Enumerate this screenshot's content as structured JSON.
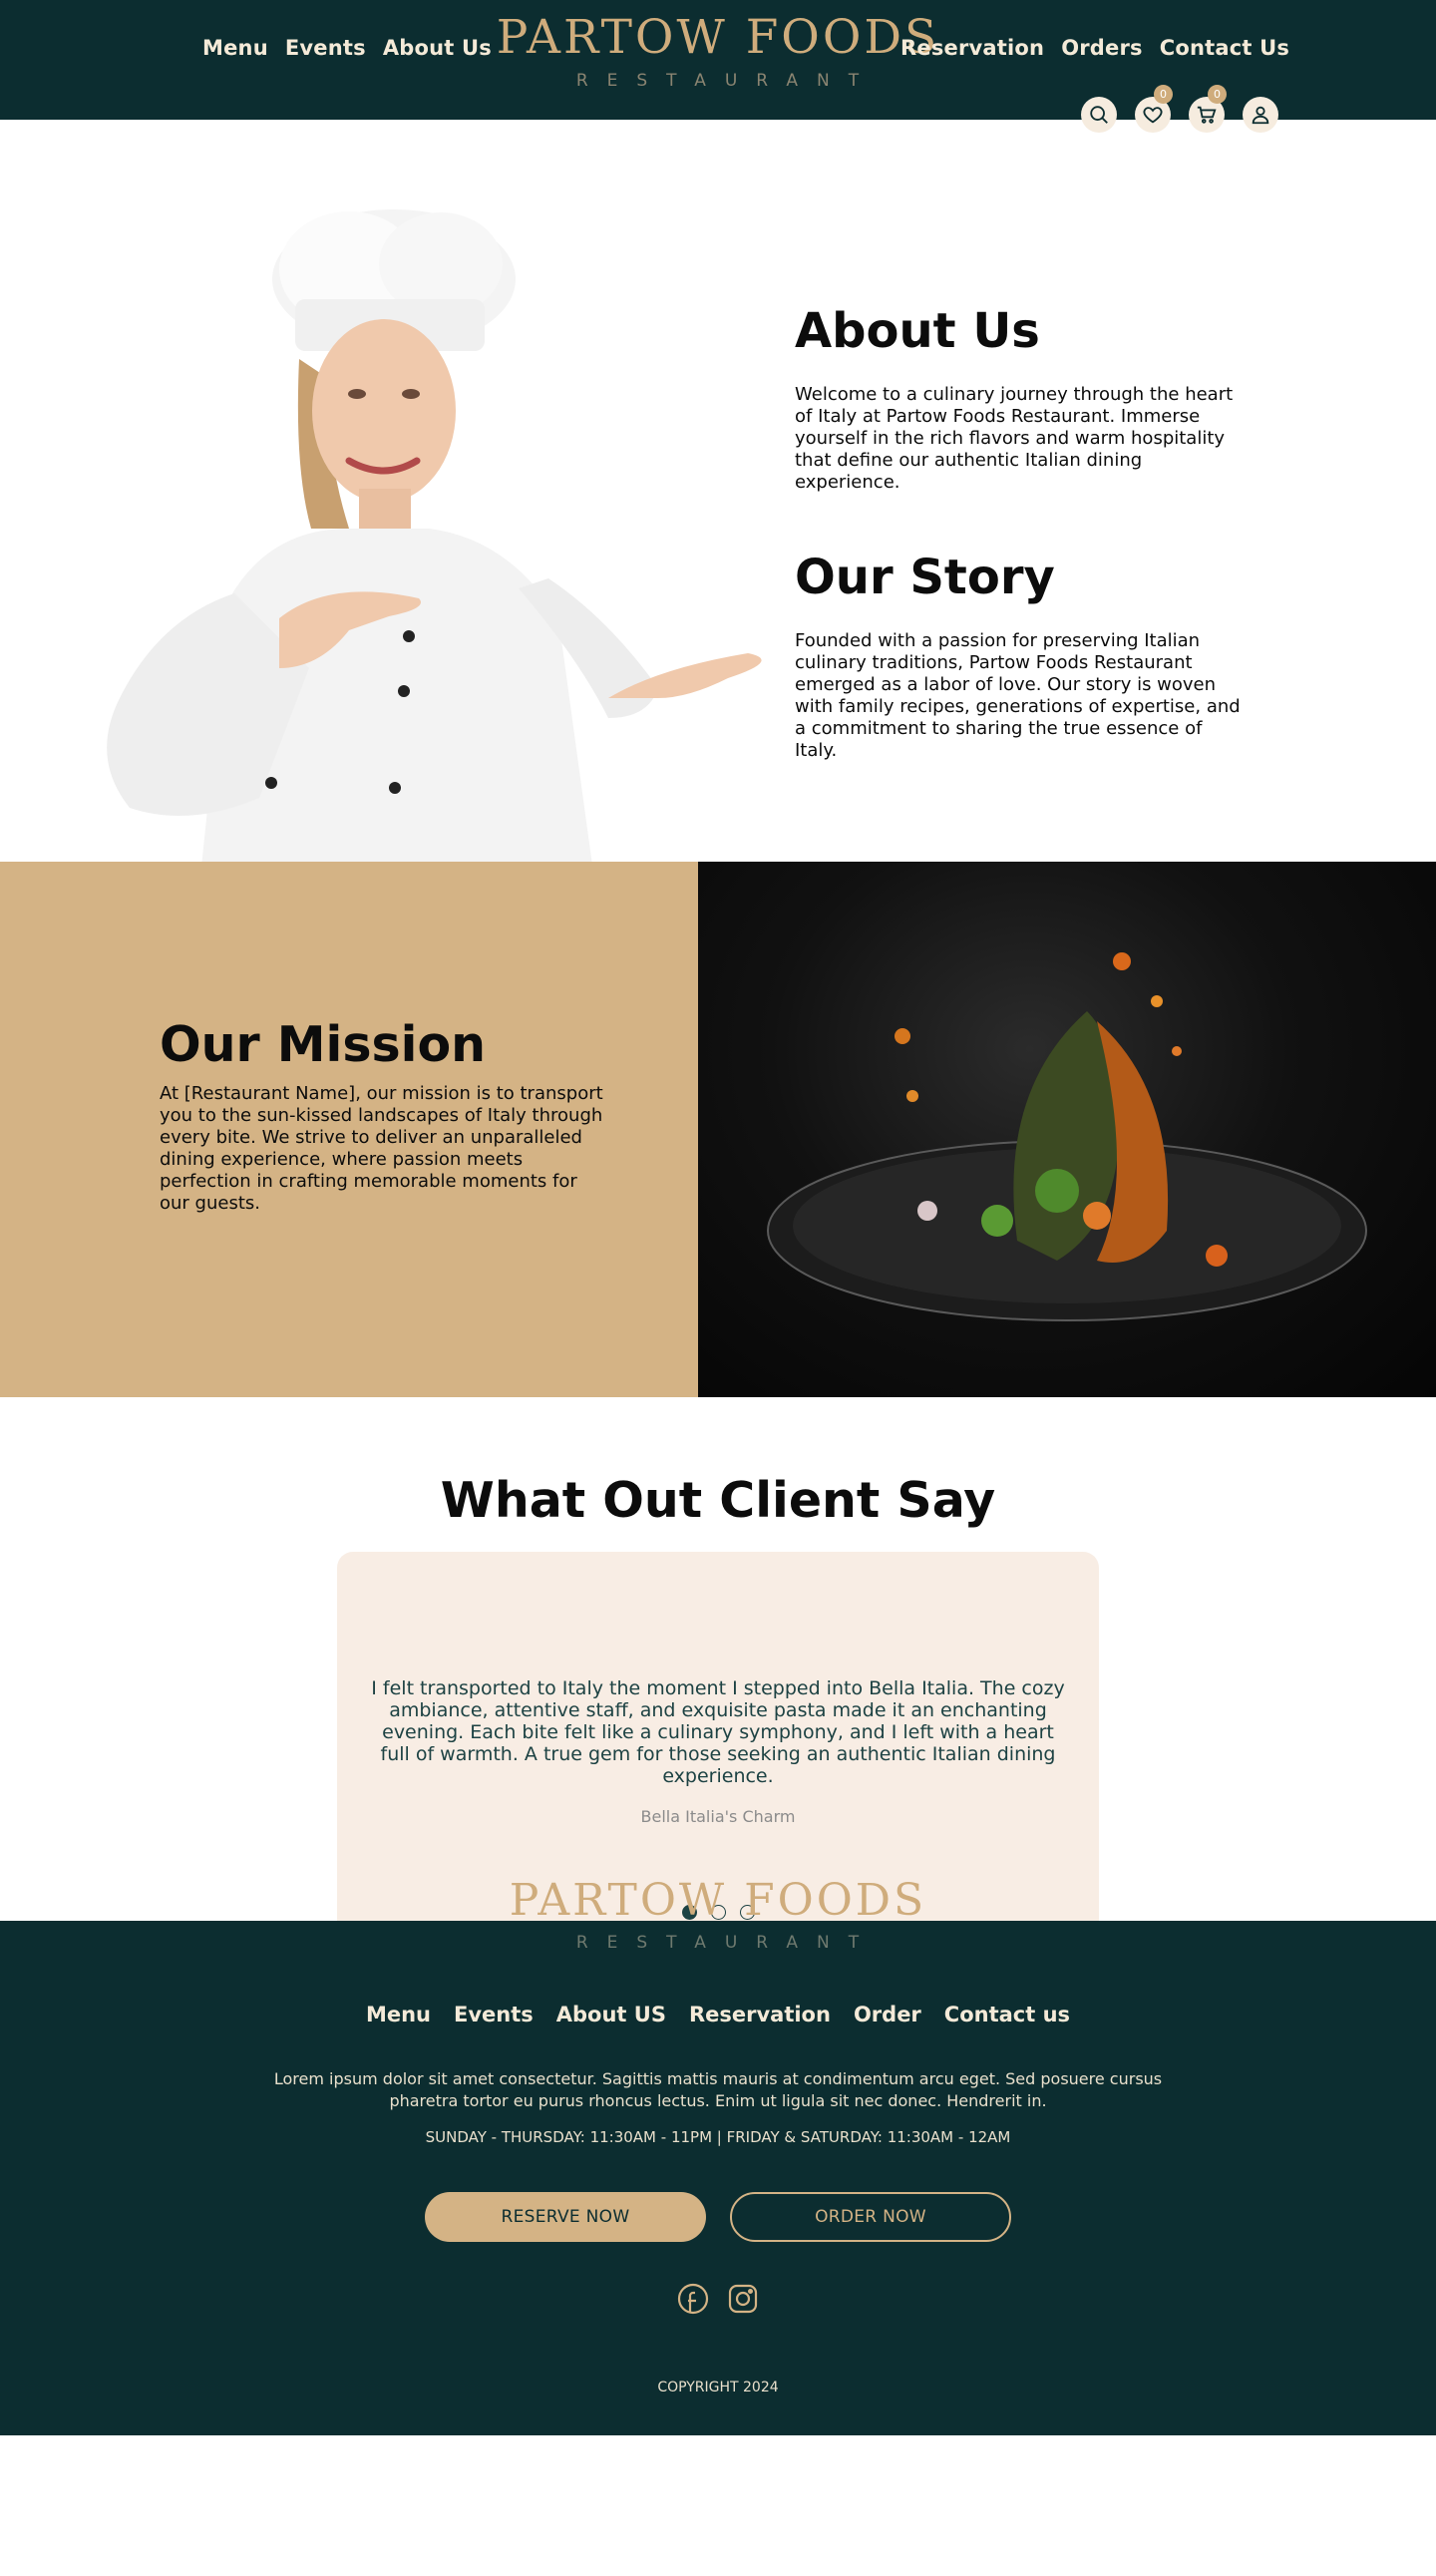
{
  "header": {
    "nav_left": [
      {
        "label": "Menu"
      },
      {
        "label": "Events"
      },
      {
        "label": "About Us"
      }
    ],
    "nav_right": [
      {
        "label": "Reservation"
      },
      {
        "label": "Orders"
      },
      {
        "label": "Contact Us"
      }
    ],
    "logo_main": "PARTOW FOODS",
    "logo_sub": "RESTAURANT",
    "icons": [
      {
        "name": "search-icon"
      },
      {
        "name": "heart-icon",
        "badge": "0"
      },
      {
        "name": "cart-icon",
        "badge": "0"
      },
      {
        "name": "user-icon"
      }
    ]
  },
  "about": {
    "title": "About Us",
    "text": "Welcome to a culinary journey through the heart of Italy at Partow Foods Restaurant. Immerse yourself in the rich flavors and warm hospitality that define our authentic Italian dining experience.",
    "story_title": "Our Story",
    "story_text": "Founded with a passion for preserving Italian culinary traditions, Partow Foods Restaurant emerged as a labor of love. Our story is woven with family recipes, generations of expertise, and a commitment to sharing the true essence of Italy."
  },
  "mission": {
    "title": "Our Mission",
    "text": "At [Restaurant Name], our mission is to transport you to the sun-kissed landscapes of Italy through every bite. We strive to deliver an unparalleled dining experience, where passion meets perfection in crafting memorable moments for our guests."
  },
  "testimonials": {
    "title": "What Out Client Say",
    "quote": "I felt transported to Italy the moment I stepped into Bella Italia. The cozy ambiance, attentive staff, and exquisite pasta made it an enchanting evening. Each bite felt like a culinary symphony, and I left with a heart full of warmth. A true gem for those seeking an authentic Italian dining experience.",
    "author": "Bella Italia's Charm"
  },
  "footer": {
    "logo_main": "PARTOW FOODS",
    "logo_sub": "RESTAURANT",
    "nav": [
      {
        "label": "Menu"
      },
      {
        "label": "Events"
      },
      {
        "label": "About US"
      },
      {
        "label": "Reservation"
      },
      {
        "label": "Order"
      },
      {
        "label": "Contact us"
      }
    ],
    "description": "Lorem ipsum dolor sit amet consectetur. Sagittis mattis mauris at condimentum arcu eget. Sed posuere cursus pharetra tortor eu purus rhoncus lectus. Enim ut ligula sit nec donec. Hendrerit in.",
    "hours": "SUNDAY - THURSDAY: 11:30AM - 11PM | FRIDAY & SATURDAY: 11:30AM - 12AM",
    "reserve_label": "RESERVE NOW",
    "order_label": "ORDER NOW",
    "social": [
      {
        "name": "facebook-icon"
      },
      {
        "name": "instagram-icon"
      }
    ],
    "copyright": "COPYRIGHT 2024"
  },
  "colors": {
    "brand_dark": "#0c2d30",
    "brand_gold": "#cfac7c",
    "mission_bg": "#d4b385",
    "card_bg": "#f8ede4"
  }
}
